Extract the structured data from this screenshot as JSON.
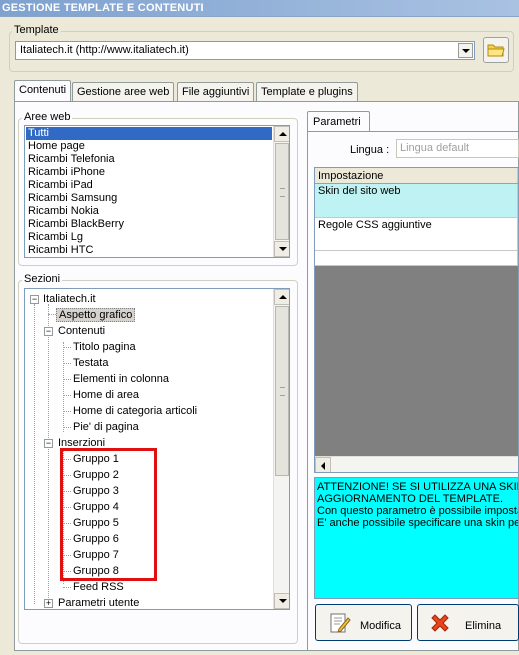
{
  "window": {
    "title": "GESTIONE TEMPLATE E CONTENUTI"
  },
  "template_group": {
    "label": "Template",
    "selected": "Italiatech.it (http://www.italiatech.it)",
    "folder_icon": "folder-icon"
  },
  "tabs": [
    {
      "label": "Contenuti",
      "active": true
    },
    {
      "label": "Gestione aree web",
      "active": false
    },
    {
      "label": "File aggiuntivi",
      "active": false
    },
    {
      "label": "Template e plugins",
      "active": false
    }
  ],
  "aree_web": {
    "label": "Aree web",
    "items": [
      "Tutti",
      "Home page",
      "Ricambi Telefonia",
      "Ricambi iPhone",
      "Ricambi iPad",
      "Ricambi Samsung",
      "Ricambi Nokia",
      "Ricambi BlackBerry",
      "Ricambi Lg",
      "Ricambi HTC"
    ],
    "selected_index": 0
  },
  "sezioni": {
    "label": "Sezioni",
    "tree": {
      "root": "Italiatech.it",
      "aspetto": "Aspetto grafico",
      "contenuti": "Contenuti",
      "contenuti_children": [
        "Titolo pagina",
        "Testata",
        "Elementi in colonna",
        "Home di area",
        "Home di categoria articoli",
        "Pie' di pagina"
      ],
      "inserzioni": "Inserzioni",
      "inserzioni_children": [
        "Gruppo 1",
        "Gruppo 2",
        "Gruppo 3",
        "Gruppo 4",
        "Gruppo 5",
        "Gruppo 6",
        "Gruppo 7",
        "Gruppo 8",
        "Feed RSS"
      ],
      "parametri_utente": "Parametri utente"
    }
  },
  "parametri": {
    "tab_label": "Parametri",
    "lingua_label": "Lingua :",
    "lingua_value": "Lingua default",
    "grid_header": "Impostazione",
    "rows": [
      "Skin del sito web",
      "Regole CSS aggiuntive"
    ],
    "info_lines": [
      "ATTENZIONE! SE SI UTILIZZA UNA SKIN P",
      "AGGIORNAMENTO DEL TEMPLATE.",
      "Con questo parametro è possibile impostar",
      "E' anche possibile specificare una skin pers"
    ],
    "buttons": {
      "modifica": "Modifica",
      "elimina": "Elimina"
    }
  },
  "colors": {
    "selection": "#316ac5",
    "info_background": "#00ffff",
    "highlight_row": "#bff2f2",
    "annotation_red": "#e01010"
  }
}
